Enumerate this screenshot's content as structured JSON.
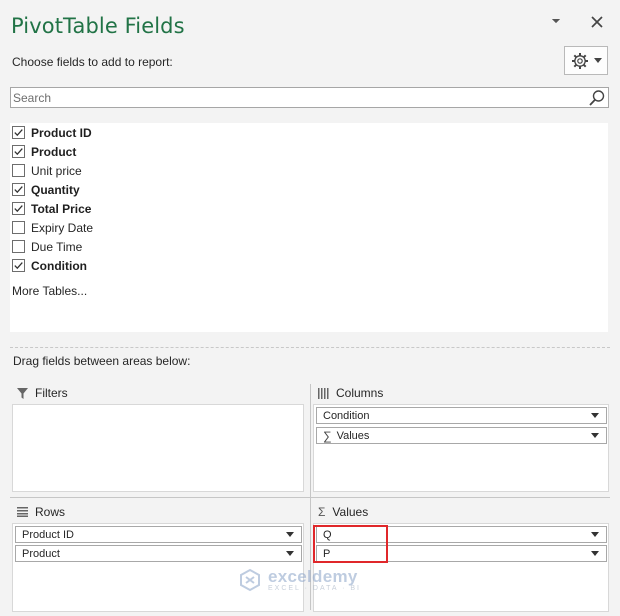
{
  "header": {
    "title": "PivotTable Fields",
    "subtitle": "Choose fields to add to report:"
  },
  "search": {
    "placeholder": "Search"
  },
  "fields": [
    {
      "label": "Product ID",
      "checked": true
    },
    {
      "label": "Product",
      "checked": true
    },
    {
      "label": "Unit price",
      "checked": false
    },
    {
      "label": "Quantity",
      "checked": true
    },
    {
      "label": "Total Price",
      "checked": true
    },
    {
      "label": "Expiry Date",
      "checked": false
    },
    {
      "label": "Due Time",
      "checked": false
    },
    {
      "label": "Condition",
      "checked": true
    }
  ],
  "more_tables": "More Tables...",
  "drag_label": "Drag fields between areas below:",
  "areas": {
    "filters": {
      "label": "Filters",
      "items": []
    },
    "columns": {
      "label": "Columns",
      "items": [
        "Condition",
        "Values"
      ]
    },
    "rows": {
      "label": "Rows",
      "items": [
        "Product ID",
        "Product"
      ]
    },
    "values": {
      "label": "Values",
      "items": [
        "Q",
        "P"
      ]
    }
  },
  "watermark": {
    "name": "exceldemy",
    "tagline": "EXCEL · DATA · BI"
  },
  "colors": {
    "accent": "#217346",
    "highlight": "#e0272a"
  }
}
